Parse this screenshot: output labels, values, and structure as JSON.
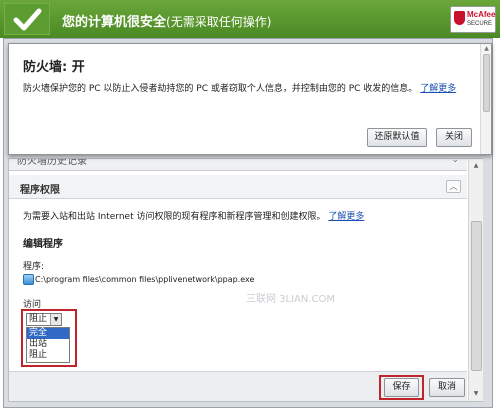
{
  "header": {
    "title": "您的计算机很安全",
    "subtitle": "(无需采取任何操作)",
    "logo_line1": "McAfee",
    "logo_line2": "SECURE"
  },
  "popup": {
    "title": "防火墙: 开",
    "description": "防火墙保护您的 PC 以防止入侵者劫持您的 PC 或者窃取个人信息，并控制由您的 PC 收发的信息。",
    "learn_more": "了解更多",
    "restore_button": "还原默认值",
    "close_button": "关闭"
  },
  "panel": {
    "collapsed_section_title": "防火墙历史记录",
    "section_title": "程序权限",
    "description": "为需要入站和出站 Internet 访问权限的现有程序和新程序管理和创建权限。",
    "learn_more": "了解更多",
    "edit_title": "编辑程序",
    "program_label": "程序:",
    "program_path": "C:\\program files\\common files\\pplivenetwork\\ppap.exe",
    "access_label": "访问",
    "access_selected": "阻止",
    "access_options": [
      "完全",
      "出站",
      "阻止"
    ],
    "watermark": "三联网 3LIAN.COM",
    "save_button": "保存",
    "cancel_button": "取消"
  },
  "colors": {
    "header_green": "#4a8a24",
    "highlight_red": "#c0252e",
    "link_blue": "#1a4fb5"
  }
}
